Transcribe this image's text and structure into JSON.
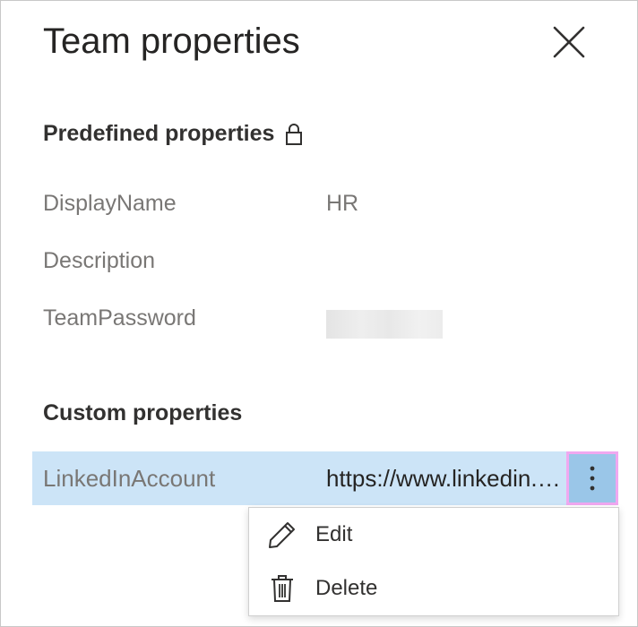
{
  "panel": {
    "title": "Team properties",
    "close_icon": "close-icon"
  },
  "predefined": {
    "header": "Predefined properties",
    "header_icon": "lock-icon",
    "rows": [
      {
        "name": "DisplayName",
        "value": "HR"
      },
      {
        "name": "Description",
        "value": ""
      },
      {
        "name": "TeamPassword",
        "value": ""
      }
    ]
  },
  "custom": {
    "header": "Custom properties",
    "rows": [
      {
        "name": "LinkedInAccount",
        "value": "https://www.linkedin.com/",
        "selected": true
      }
    ],
    "more_icon": "more-vertical-icon"
  },
  "context_menu": {
    "items": [
      {
        "label": "Edit",
        "icon": "pencil-icon"
      },
      {
        "label": "Delete",
        "icon": "trash-icon"
      }
    ]
  },
  "colors": {
    "selected_row_bg": "#cce4f7",
    "more_button_bg": "#9ac6e8",
    "focus_outline": "#f0a8f0",
    "label_gray": "#797775"
  }
}
